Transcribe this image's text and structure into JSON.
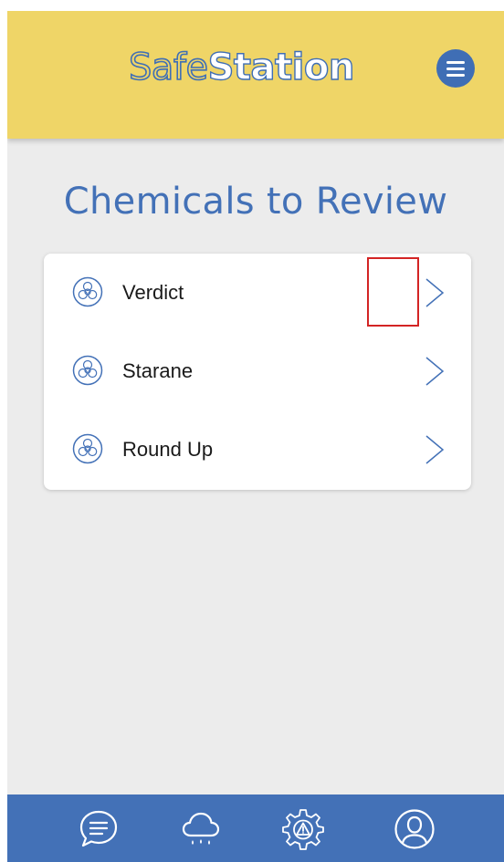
{
  "header": {
    "logo_part1": "Safe",
    "logo_part2": "Station",
    "menu_icon": "hamburger-menu-icon"
  },
  "page": {
    "title": "Chemicals to Review"
  },
  "chemicals": [
    {
      "name": "Verdict",
      "icon": "biohazard-icon"
    },
    {
      "name": "Starane",
      "icon": "biohazard-icon"
    },
    {
      "name": "Round Up",
      "icon": "biohazard-icon"
    }
  ],
  "bottom_nav": [
    {
      "icon": "chat-icon"
    },
    {
      "icon": "weather-rain-icon"
    },
    {
      "icon": "hazard-gear-icon"
    },
    {
      "icon": "profile-icon"
    }
  ],
  "colors": {
    "header_bg": "#efd567",
    "brand_blue": "#4371b7",
    "background": "#ececec",
    "highlight": "#d32424"
  }
}
